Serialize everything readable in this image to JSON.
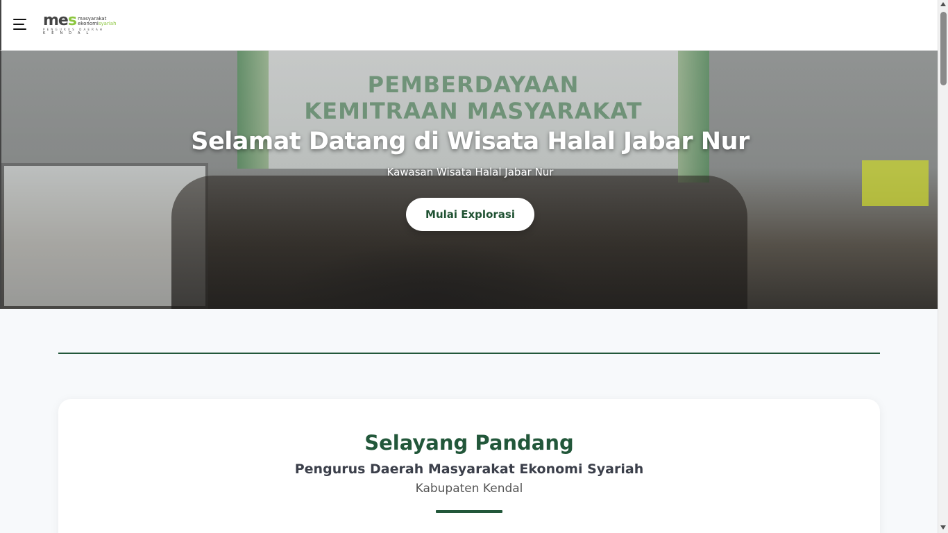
{
  "header": {
    "logo": {
      "mark_main": "me",
      "mark_accent": "s",
      "line1": "masyarakat",
      "line2_a": "ekonomi",
      "line2_b": "syariah",
      "line3": "PENGURUS DAERAH",
      "line4": "KENDAL"
    },
    "menu_icon": "hamburger-menu-icon"
  },
  "hero": {
    "title": "Selamat Datang di Wisata Halal Jabar Nur",
    "subtitle": "Kawasan Wisata Halal Jabar Nur",
    "cta_label": "Mulai Explorasi",
    "banner_text": "PEMBERDAYAAN KEMITRAAN MASYARAKAT"
  },
  "about": {
    "title": "Selayang Pandang",
    "subtitle": "Pengurus Daerah Masyarakat Ekonomi Syariah",
    "region": "Kabupaten Kendal"
  },
  "colors": {
    "primary_green": "#22573a",
    "accent_lime": "#8cc63f",
    "background": "#f7f9fb"
  }
}
